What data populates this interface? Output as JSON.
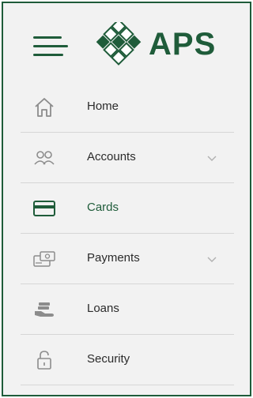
{
  "colors": {
    "brand_green": "#1f5c3a",
    "text": "#2b2b2b",
    "icon_gray": "#8c8c8c",
    "background": "#f2f2f2"
  },
  "header": {
    "menu_icon": "hamburger-menu-icon",
    "logo_text": "APS"
  },
  "menu": {
    "items": [
      {
        "label": "Home",
        "icon": "home-icon",
        "has_submenu": false
      },
      {
        "label": "Accounts",
        "icon": "accounts-icon",
        "has_submenu": true
      },
      {
        "label": "Cards",
        "icon": "card-icon",
        "has_submenu": false
      },
      {
        "label": "Payments",
        "icon": "payments-icon",
        "has_submenu": true
      },
      {
        "label": "Loans",
        "icon": "loans-icon",
        "has_submenu": false
      },
      {
        "label": "Security",
        "icon": "lock-icon",
        "has_submenu": false
      }
    ]
  }
}
